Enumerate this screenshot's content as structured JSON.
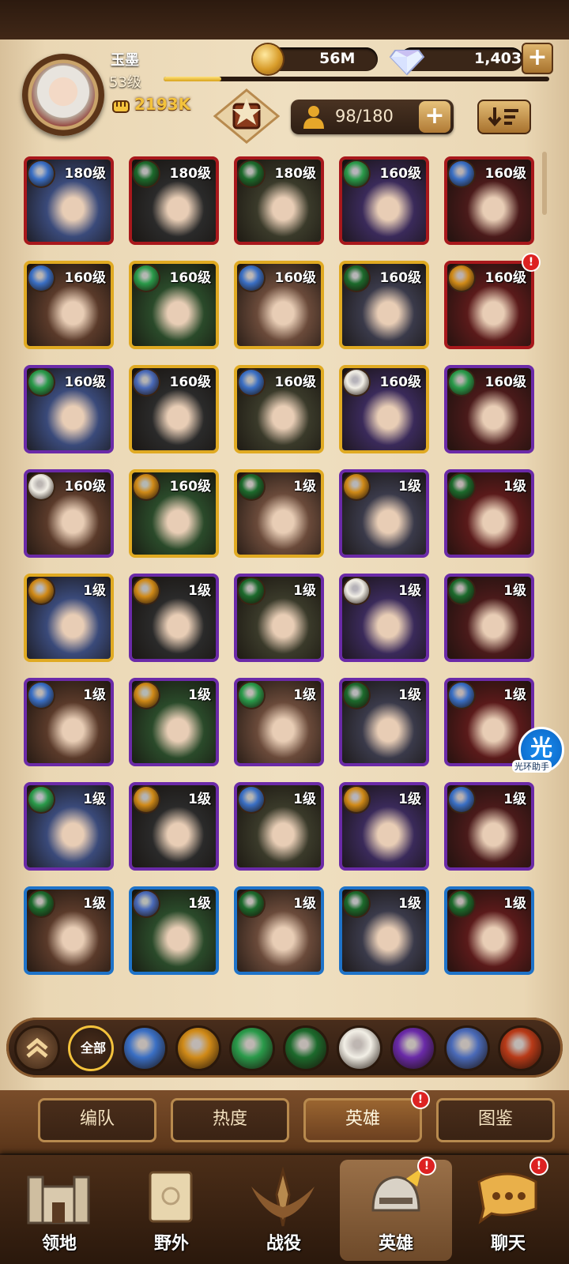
{
  "player": {
    "name": "玉墨",
    "level": "53级",
    "xp_fraction": 0.15,
    "power": "2193K"
  },
  "resources": {
    "gold": "56M",
    "diamonds": "1,403",
    "hero_capacity": "98/180"
  },
  "icons": {
    "power": "fist-icon",
    "gold": "gold-coin-icon",
    "diamond": "diamond-icon",
    "capacity": "person-icon",
    "sort": "sort-icon",
    "emblem": "guild-emblem-icon",
    "assistant": "光"
  },
  "assistant": {
    "label": "光环助手"
  },
  "heroes": [
    {
      "level": "180级",
      "rarity": "red",
      "faction": "lightbearer",
      "alert": false
    },
    {
      "level": "180级",
      "rarity": "red",
      "faction": "graveborn",
      "alert": false
    },
    {
      "level": "180级",
      "rarity": "red",
      "faction": "graveborn",
      "alert": false
    },
    {
      "level": "160级",
      "rarity": "red",
      "faction": "wilder",
      "alert": false
    },
    {
      "level": "160级",
      "rarity": "red",
      "faction": "lightbearer",
      "alert": false
    },
    {
      "level": "160级",
      "rarity": "gold",
      "faction": "lightbearer",
      "alert": false
    },
    {
      "level": "160级",
      "rarity": "gold",
      "faction": "wilder",
      "alert": false
    },
    {
      "level": "160级",
      "rarity": "gold",
      "faction": "lightbearer",
      "alert": false
    },
    {
      "level": "160级",
      "rarity": "gold",
      "faction": "graveborn",
      "alert": false
    },
    {
      "level": "160级",
      "rarity": "red",
      "faction": "mauler",
      "alert": true
    },
    {
      "level": "160级",
      "rarity": "purple",
      "faction": "wilder",
      "alert": false
    },
    {
      "level": "160级",
      "rarity": "gold",
      "faction": "dimensional",
      "alert": false
    },
    {
      "level": "160级",
      "rarity": "gold",
      "faction": "lightbearer",
      "alert": false
    },
    {
      "level": "160级",
      "rarity": "gold",
      "faction": "celestial",
      "alert": false
    },
    {
      "level": "160级",
      "rarity": "purple",
      "faction": "wilder",
      "alert": false
    },
    {
      "level": "160级",
      "rarity": "purple",
      "faction": "celestial",
      "alert": false
    },
    {
      "level": "160级",
      "rarity": "gold",
      "faction": "mauler",
      "alert": false
    },
    {
      "level": "1级",
      "rarity": "gold",
      "faction": "graveborn",
      "alert": false
    },
    {
      "level": "1级",
      "rarity": "purple",
      "faction": "mauler",
      "alert": false
    },
    {
      "level": "1级",
      "rarity": "purple",
      "faction": "graveborn",
      "alert": false
    },
    {
      "level": "1级",
      "rarity": "gold",
      "faction": "mauler",
      "alert": false
    },
    {
      "level": "1级",
      "rarity": "purple",
      "faction": "mauler",
      "alert": false
    },
    {
      "level": "1级",
      "rarity": "purple",
      "faction": "graveborn",
      "alert": false
    },
    {
      "level": "1级",
      "rarity": "purple",
      "faction": "celestial",
      "alert": false
    },
    {
      "level": "1级",
      "rarity": "purple",
      "faction": "graveborn",
      "alert": false
    },
    {
      "level": "1级",
      "rarity": "purple",
      "faction": "lightbearer",
      "alert": false
    },
    {
      "level": "1级",
      "rarity": "purple",
      "faction": "mauler",
      "alert": false
    },
    {
      "level": "1级",
      "rarity": "purple",
      "faction": "wilder",
      "alert": false
    },
    {
      "level": "1级",
      "rarity": "purple",
      "faction": "graveborn",
      "alert": false
    },
    {
      "level": "1级",
      "rarity": "purple",
      "faction": "lightbearer",
      "alert": false
    },
    {
      "level": "1级",
      "rarity": "purple",
      "faction": "wilder",
      "alert": false
    },
    {
      "level": "1级",
      "rarity": "purple",
      "faction": "mauler",
      "alert": false
    },
    {
      "level": "1级",
      "rarity": "purple",
      "faction": "lightbearer",
      "alert": false
    },
    {
      "level": "1级",
      "rarity": "purple",
      "faction": "mauler",
      "alert": false
    },
    {
      "level": "1级",
      "rarity": "purple",
      "faction": "lightbearer",
      "alert": false
    },
    {
      "level": "1级",
      "rarity": "blue",
      "faction": "graveborn",
      "alert": false
    },
    {
      "level": "1级",
      "rarity": "blue",
      "faction": "dimensional",
      "alert": false
    },
    {
      "level": "1级",
      "rarity": "blue",
      "faction": "graveborn",
      "alert": false
    },
    {
      "level": "1级",
      "rarity": "blue",
      "faction": "graveborn",
      "alert": false
    },
    {
      "level": "1级",
      "rarity": "blue",
      "faction": "graveborn",
      "alert": false
    }
  ],
  "filters": [
    {
      "id": "collapse",
      "label": ""
    },
    {
      "id": "all",
      "label": "全部"
    },
    {
      "id": "lightbearer",
      "label": ""
    },
    {
      "id": "mauler",
      "label": ""
    },
    {
      "id": "wilder",
      "label": ""
    },
    {
      "id": "graveborn",
      "label": ""
    },
    {
      "id": "celestial",
      "label": ""
    },
    {
      "id": "hypogean",
      "label": ""
    },
    {
      "id": "dimensional",
      "label": ""
    },
    {
      "id": "dragon",
      "label": ""
    }
  ],
  "subtabs": [
    {
      "label": "编队",
      "active": false,
      "alert": false
    },
    {
      "label": "热度",
      "active": false,
      "alert": false
    },
    {
      "label": "英雄",
      "active": true,
      "alert": true
    },
    {
      "label": "图鉴",
      "active": false,
      "alert": false
    }
  ],
  "nav": [
    {
      "label": "领地",
      "icon": "castle-icon",
      "active": false,
      "alert": false
    },
    {
      "label": "野外",
      "icon": "map-scroll-icon",
      "active": false,
      "alert": false
    },
    {
      "label": "战役",
      "icon": "crossed-swords-icon",
      "active": false,
      "alert": false
    },
    {
      "label": "英雄",
      "icon": "helmet-icon",
      "active": true,
      "alert": true
    },
    {
      "label": "聊天",
      "icon": "chat-bubble-icon",
      "active": false,
      "alert": true
    }
  ],
  "colors": {
    "rarity_red": "#a8181c",
    "rarity_gold": "#e0aa22",
    "rarity_purple": "#6b2aa8",
    "rarity_blue": "#1e73c9",
    "faction_lightbearer": "#3a6fc4",
    "faction_mauler": "#d08a18",
    "faction_wilder": "#2a9a4a",
    "faction_graveborn": "#1c6a2c",
    "faction_celestial": "#f2efe6",
    "faction_hypogean": "#6a2aa8",
    "faction_dimensional": "#4a6ab8",
    "faction_dragon": "#b83a18"
  }
}
